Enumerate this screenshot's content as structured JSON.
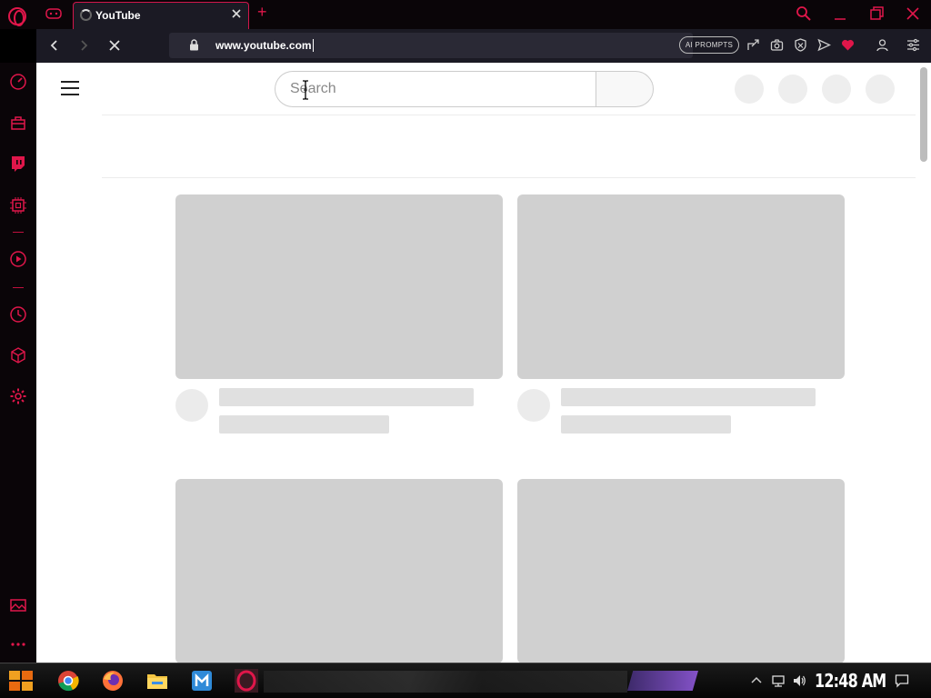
{
  "browser": {
    "tab": {
      "title": "YouTube"
    },
    "url": "www.youtube.com",
    "ai_prompts_label": "AI PROMPTS"
  },
  "page": {
    "search": {
      "placeholder": "Search"
    }
  },
  "taskbar": {
    "clock": "12:48 AM"
  },
  "colors": {
    "accent": "#e0164a",
    "skeleton": "#d0d0d0",
    "chrome_bg": "#1b1a24"
  }
}
